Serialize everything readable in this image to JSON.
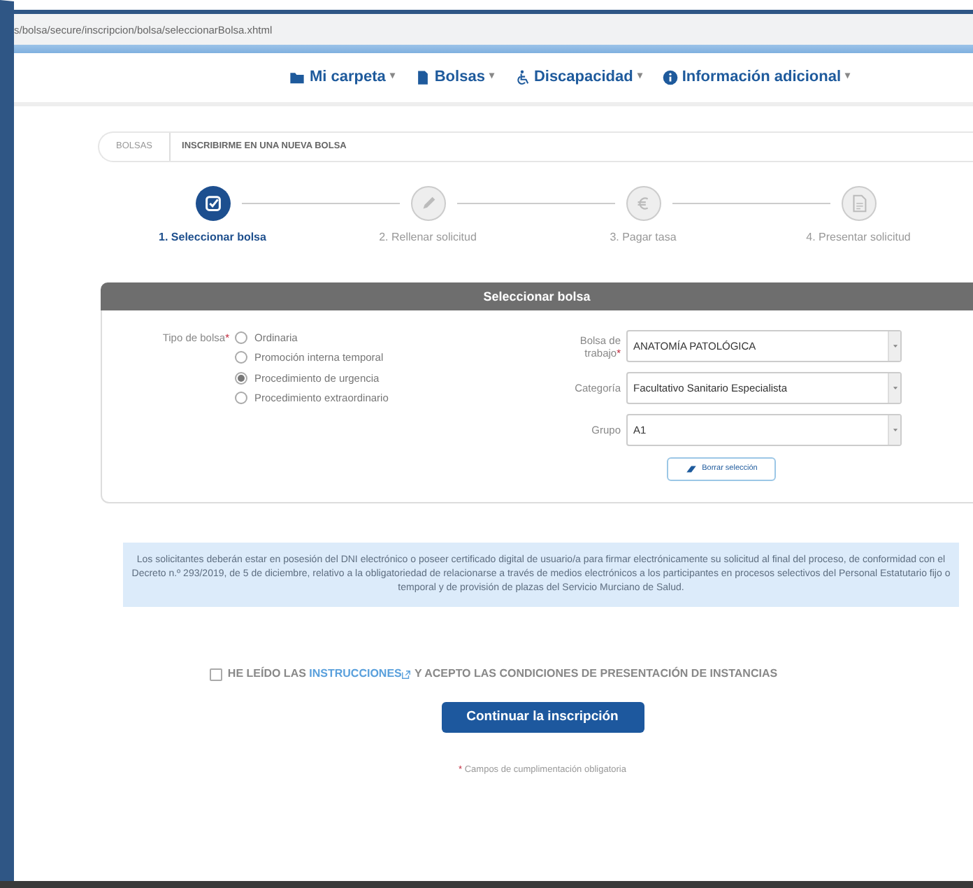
{
  "address_bar": {
    "url": "s/bolsa/secure/inscripcion/bolsa/seleccionarBolsa.xhtml"
  },
  "nav": [
    {
      "label": "Mi carpeta",
      "kind": "folder",
      "caret": "▾"
    },
    {
      "label": "Bolsas",
      "kind": "document",
      "caret": "▾"
    },
    {
      "label": "Discapacidad",
      "kind": "wheelchair",
      "caret": "▾"
    },
    {
      "label": "Información adicional",
      "kind": "info",
      "caret": "▾"
    }
  ],
  "breadcrumb": [
    "BOLSAS",
    "INSCRIBIRME EN UNA NUEVA BOLSA"
  ],
  "steps": [
    {
      "label": "1. Seleccionar bolsa",
      "kind": "check",
      "selected": true
    },
    {
      "label": "2. Rellenar solicitud",
      "kind": "pencil",
      "selected": false
    },
    {
      "label": "3. Pagar tasa",
      "kind": "euro",
      "selected": false
    },
    {
      "label": "4. Presentar solicitud",
      "kind": "file",
      "selected": false
    }
  ],
  "panel": {
    "title": "Seleccionar bolsa",
    "tipo_label": "Tipo de bolsa",
    "tipo_mark": "*",
    "options": [
      {
        "label": "Ordinaria",
        "selected": false
      },
      {
        "label": "Promoción interna temporal",
        "selected": false
      },
      {
        "label": "Procedimiento de urgencia",
        "selected": true
      },
      {
        "label": "Procedimiento extraordinario",
        "selected": false
      }
    ],
    "fields": [
      {
        "label": "Bolsa de trabajo",
        "mark": "*",
        "value": "ANATOMÍA PATOLÓGICA"
      },
      {
        "label": "Categoría",
        "value": "Facultativo Sanitario Especialista"
      },
      {
        "label": "Grupo",
        "value": "A1"
      }
    ],
    "clear_button": "Borrar selección"
  },
  "notice": "Los solicitantes deberán estar en posesión del DNI electrónico o poseer certificado digital de usuario/a para firmar electrónicamente su solicitud al final del proceso, de conformidad con el Decreto n.º 293/2019, de 5 de diciembre, relativo a la obligatoriedad de relacionarse a través de medios electrónicos a los participantes en procesos selectivos del Personal Estatutario fijo o temporal y de provisión de plazas del Servicio Murciano de Salud.",
  "consent": {
    "checked": false,
    "before": "HE LEÍDO LAS",
    "link": "INSTRUCCIONES",
    "after": "Y ACEPTO LAS CONDICIONES DE PRESENTACIÓN DE INSTANCIAS"
  },
  "submit_button": "Continuar la inscripción",
  "required_note": {
    "mark": "*",
    "text": "Campos de cumplimentación obligatoria"
  }
}
